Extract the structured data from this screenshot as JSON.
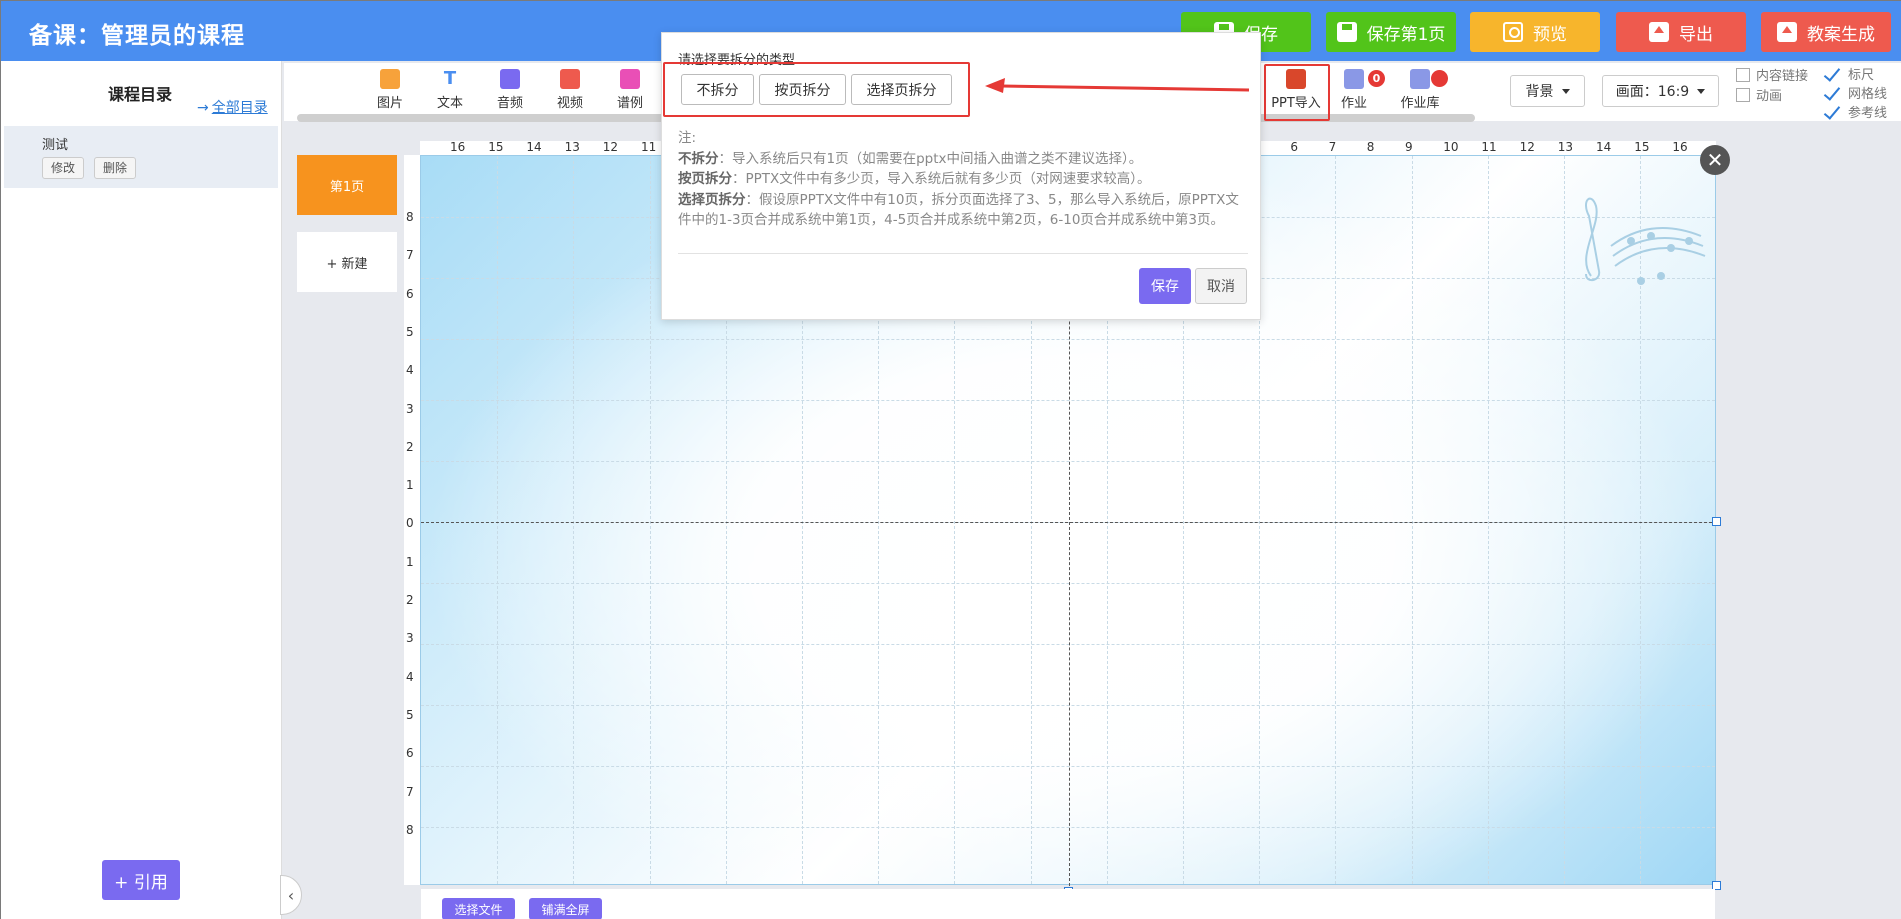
{
  "header": {
    "title": "备课：管理员的课程",
    "buttons": {
      "save": "保存",
      "save_page1": "保存第1页",
      "preview": "预览",
      "export": "导出",
      "lesson_plan": "教案生成"
    }
  },
  "sidebar": {
    "title": "课程目录",
    "all_link": "全部目录",
    "item": {
      "name": "测试",
      "edit": "修改",
      "delete": "删除"
    },
    "cite_button": "+ 引用"
  },
  "toolbar": {
    "tools": [
      "图片",
      "文本",
      "音频",
      "视频",
      "谱例"
    ],
    "ppt_import": "PPT导入",
    "homework": "作业",
    "homework_badge": "0",
    "homework_lib": "作业库",
    "background": "背景",
    "aspect": "画面：16:9",
    "checks": {
      "content_link": "内容链接",
      "animation": "动画",
      "ruler": "标尺",
      "grid": "网格线",
      "guides": "参考线"
    }
  },
  "pages": {
    "page1": "第1页",
    "new": "+ 新建"
  },
  "ruler": {
    "top": [
      "16",
      "15",
      "14",
      "13",
      "12",
      "11",
      "",
      "",
      "",
      "",
      "",
      "",
      "",
      "",
      "",
      "",
      "",
      "",
      "",
      "",
      "",
      "",
      "6",
      "7",
      "8",
      "9",
      "10",
      "11",
      "12",
      "13",
      "14",
      "15",
      "16"
    ],
    "left": [
      "8",
      "7",
      "6",
      "5",
      "4",
      "3",
      "2",
      "1",
      "0",
      "1",
      "2",
      "3",
      "4",
      "5",
      "6",
      "7",
      "8"
    ]
  },
  "bottom": {
    "select_file": "选择文件",
    "fill_screen": "铺满全屏"
  },
  "dialog": {
    "title": "请选择要拆分的类型",
    "options": [
      "不拆分",
      "按页拆分",
      "选择页拆分"
    ],
    "note_label": "注:",
    "notes": [
      {
        "label": "不拆分",
        "text": "：导入系统后只有1页（如需要在pptx中间插入曲谱之类不建议选择）。"
      },
      {
        "label": "按页拆分",
        "text": "：PPTX文件中有多少页，导入系统后就有多少页（对网速要求较高）。"
      },
      {
        "label": "选择页拆分",
        "text": "：假设原PPTX文件中有10页，拆分页面选择了3、5，那么导入系统后，原PPTX文件中的1-3页合并成系统中第1页，4-5页合并成系统中第2页，6-10页合并成系统中第3页。"
      }
    ],
    "save": "保存",
    "cancel": "取消"
  },
  "colors": {
    "header_bg": "#4a8ef0",
    "green": "#52c41a",
    "orange": "#f7b52c",
    "red": "#ee5a4e",
    "purple": "#7a6af0",
    "page_active": "#f7931e",
    "highlight_red": "#e53935"
  },
  "icons": {
    "save": "floppy-icon",
    "preview": "magnifier-icon",
    "export": "upload-icon",
    "close": "close-icon",
    "collapse": "chevron-left-icon"
  }
}
